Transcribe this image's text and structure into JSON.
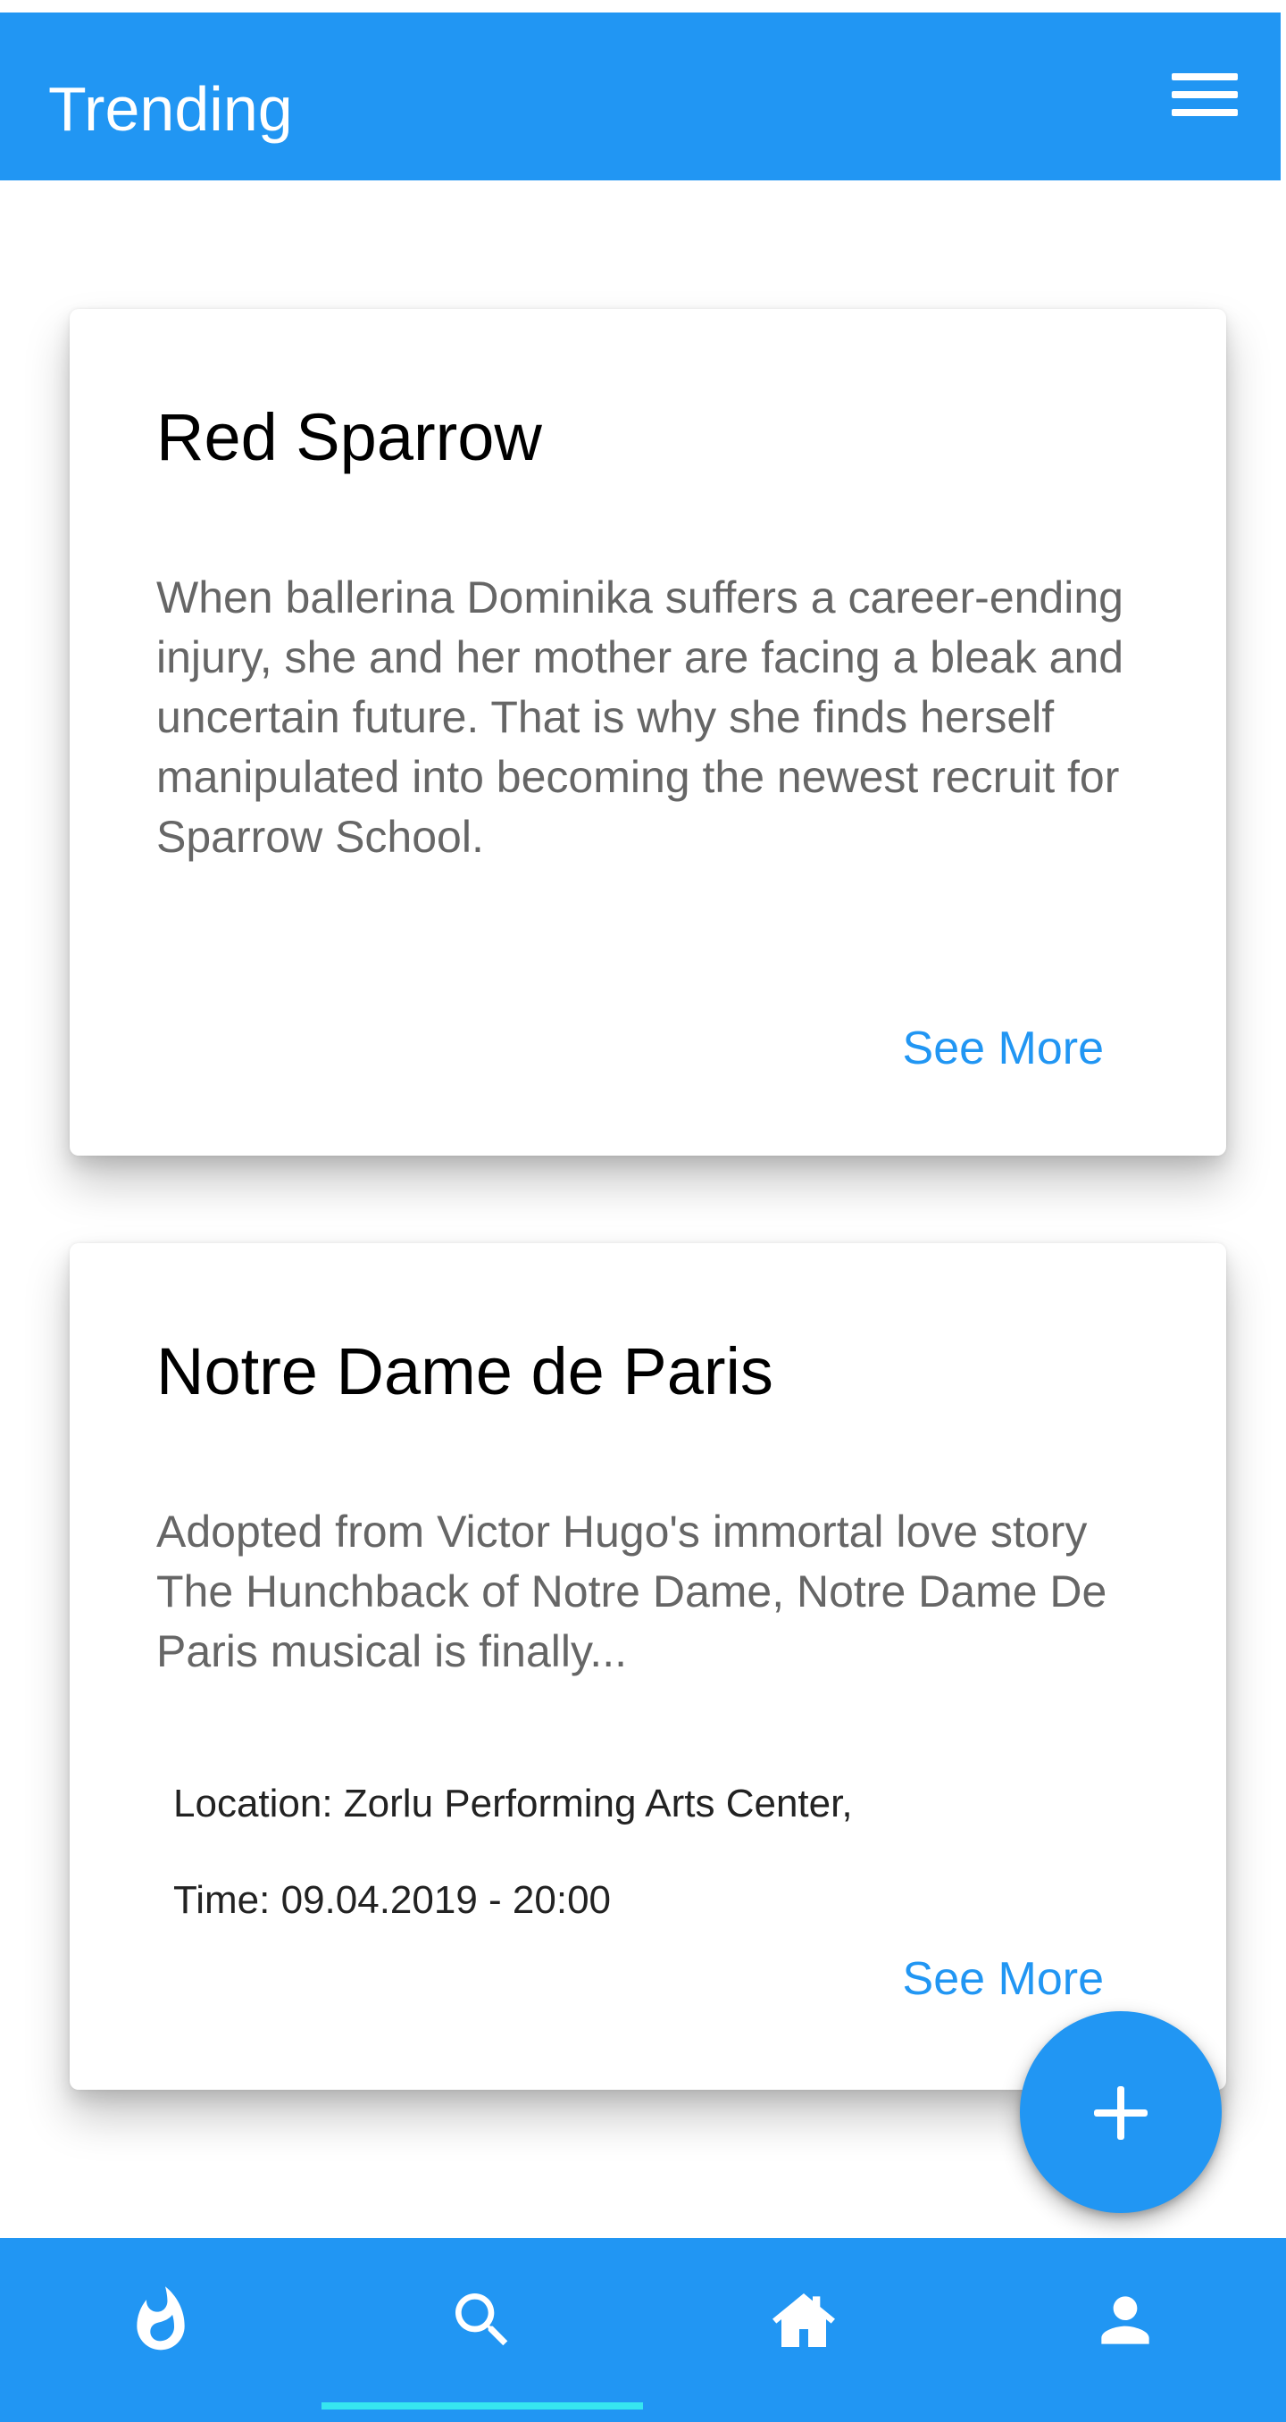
{
  "app_bar": {
    "title": "Trending",
    "menu_icon": "hamburger-menu-icon"
  },
  "cards": [
    {
      "title": "Red Sparrow",
      "description": "When ballerina Dominika suffers a career-ending injury, she and her mother are facing a bleak and uncertain future. That is why she finds herself manipulated into becoming the newest recruit for Sparrow School.",
      "see_more": "See More"
    },
    {
      "title": "Notre Dame de Paris",
      "description": "Adopted from Victor Hugo's immortal love story The Hunchback of Notre Dame, Notre Dame De Paris musical is finally...",
      "location": "Location: Zorlu Performing Arts Center,",
      "time": "Time: 09.04.2019 - 20:00",
      "see_more": "See More"
    }
  ],
  "fab": {
    "icon": "plus-icon"
  },
  "bottom_nav": {
    "items": [
      {
        "icon": "fire-icon",
        "selected": false
      },
      {
        "icon": "search-icon",
        "selected": true
      },
      {
        "icon": "home-icon",
        "selected": false
      },
      {
        "icon": "person-icon",
        "selected": false
      }
    ]
  },
  "colors": {
    "primary": "#2196F3",
    "indicator": "#36E6F0",
    "title_text": "#000000",
    "body_text": "#666666"
  }
}
